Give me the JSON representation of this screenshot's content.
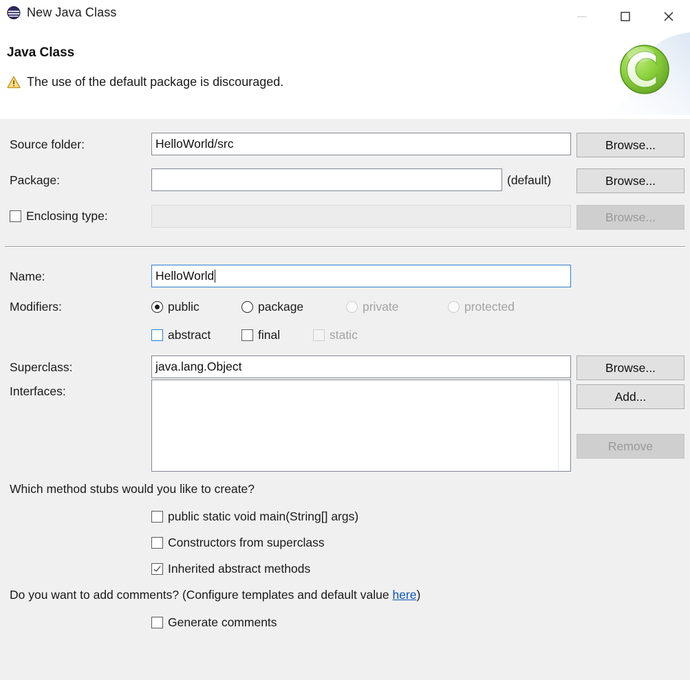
{
  "window": {
    "title": "New Java Class",
    "icon": "eclipse-wizard-sphere-icon",
    "controls": {
      "minimize_label": "—",
      "maximize_label": "□",
      "close_label": "✕"
    }
  },
  "header": {
    "title": "Java Class",
    "message": "The use of the default package is discouraged.",
    "message_icon": "warning-triangle-icon",
    "banner_icon": "green-c-class-icon"
  },
  "form": {
    "source_folder": {
      "label": "Source folder:",
      "value": "HelloWorld/src",
      "browse_label": "Browse..."
    },
    "package": {
      "label": "Package:",
      "value": "",
      "hint": "(default)",
      "browse_label": "Browse..."
    },
    "enclosing_type": {
      "label": "Enclosing type:",
      "checked": false,
      "value": "",
      "browse_label": "Browse...",
      "disabled": true
    },
    "name": {
      "label": "Name:",
      "value": "HelloWorld"
    },
    "modifiers": {
      "label": "Modifiers:",
      "visibility": [
        {
          "label": "public",
          "selected": true,
          "disabled": false
        },
        {
          "label": "package",
          "selected": false,
          "disabled": false
        },
        {
          "label": "private",
          "selected": false,
          "disabled": true
        },
        {
          "label": "protected",
          "selected": false,
          "disabled": true
        }
      ],
      "flags": [
        {
          "label": "abstract",
          "checked": false,
          "disabled": false
        },
        {
          "label": "final",
          "checked": false,
          "disabled": false
        },
        {
          "label": "static",
          "checked": false,
          "disabled": true
        }
      ]
    },
    "superclass": {
      "label": "Superclass:",
      "value": "java.lang.Object",
      "browse_label": "Browse..."
    },
    "interfaces": {
      "label": "Interfaces:",
      "items": [],
      "add_label": "Add...",
      "remove_label": "Remove",
      "remove_disabled": true
    },
    "method_stubs": {
      "question": "Which method stubs would you like to create?",
      "options": [
        {
          "label": "public static void main(String[] args)",
          "checked": false
        },
        {
          "label": "Constructors from superclass",
          "checked": false
        },
        {
          "label": "Inherited abstract methods",
          "checked": true
        }
      ]
    },
    "comments": {
      "question_prefix": "Do you want to add comments? (Configure templates and default value ",
      "link_label": "here",
      "question_suffix": ")",
      "option": {
        "label": "Generate comments",
        "checked": false
      }
    }
  },
  "colors": {
    "dialog_background": "#f0f0f0",
    "header_background": "#ffffff",
    "accent_blue": "#2a7fd4",
    "link_blue": "#0b55b5",
    "warning_amber": "#f0c419",
    "class_icon_green": "#7cc043"
  }
}
